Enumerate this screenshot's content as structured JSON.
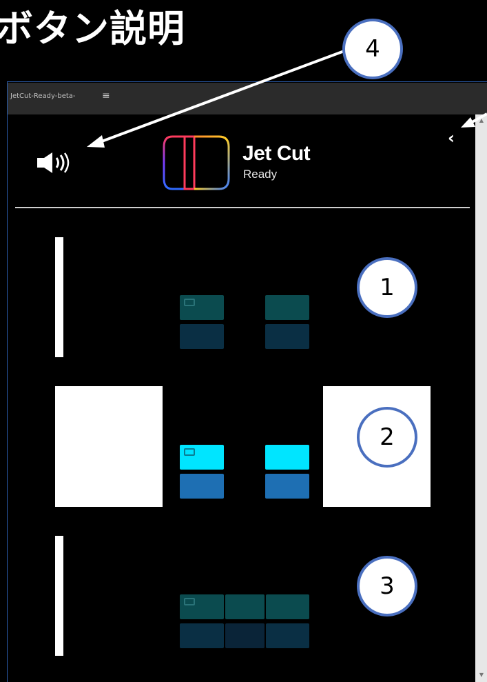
{
  "heading": "ボタン説明",
  "panel": {
    "title": "JetCut-Ready-beta-",
    "menu_icon": "≡",
    "collapse_icon": "‹",
    "scroll_up": "▲",
    "scroll_down": "▼"
  },
  "logo": {
    "word": "Jet Cut",
    "sub": "Ready"
  },
  "callouts": [
    "1",
    "2",
    "3",
    "4"
  ],
  "colors": {
    "panel_border": "#2a5aa8",
    "callout_border": "#4a6fbf",
    "clip_active": "#00e5ff",
    "clip_inactive": "#0b4b4f"
  },
  "icons": {
    "speaker": "speaker-icon",
    "collapse": "chevron-left-icon",
    "menu": "hamburger-menu-icon"
  }
}
